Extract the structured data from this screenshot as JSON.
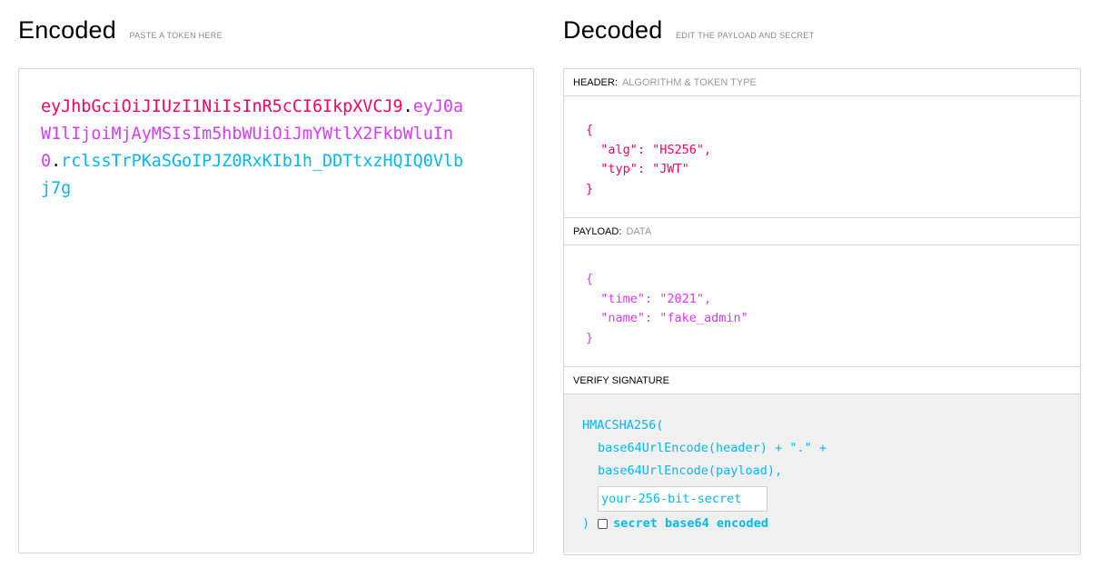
{
  "encoded": {
    "title": "Encoded",
    "subtitle": "PASTE A TOKEN HERE",
    "token": {
      "header": "eyJhbGciOiJIUzI1NiIsInR5cCI6IkpXVCJ9",
      "payload": "eyJ0aW1lIjoiMjAyMSIsIm5hbWUiOiJmYWtlX2FkbWluIn0",
      "signature": "rclssTrPKaSGoIPJZ0RxKIb1h_DDTtxzHQIQ0Vlbj7g",
      "separator": "."
    }
  },
  "decoded": {
    "title": "Decoded",
    "subtitle": "EDIT THE PAYLOAD AND SECRET",
    "header_section": {
      "label": "HEADER:",
      "desc": "ALGORITHM & TOKEN TYPE",
      "lines": [
        "{",
        "  \"alg\": \"HS256\",",
        "  \"typ\": \"JWT\"",
        "}"
      ]
    },
    "payload_section": {
      "label": "PAYLOAD:",
      "desc": "DATA",
      "lines": [
        "{",
        "  \"time\": \"2021\",",
        "  \"name\": \"fake_admin\"",
        "}"
      ]
    },
    "verify_section": {
      "label": "VERIFY SIGNATURE",
      "fn_open": "HMACSHA256(",
      "line_header": "base64UrlEncode(header) + \".\" +",
      "line_payload": "base64UrlEncode(payload),",
      "secret_placeholder": "your-256-bit-secret",
      "close": ")",
      "base64_checkbox_label": "secret base64 encoded",
      "base64_checked": false
    }
  },
  "colors": {
    "header": "#fb015b",
    "payload": "#d63aff",
    "signature": "#00b9f1"
  }
}
